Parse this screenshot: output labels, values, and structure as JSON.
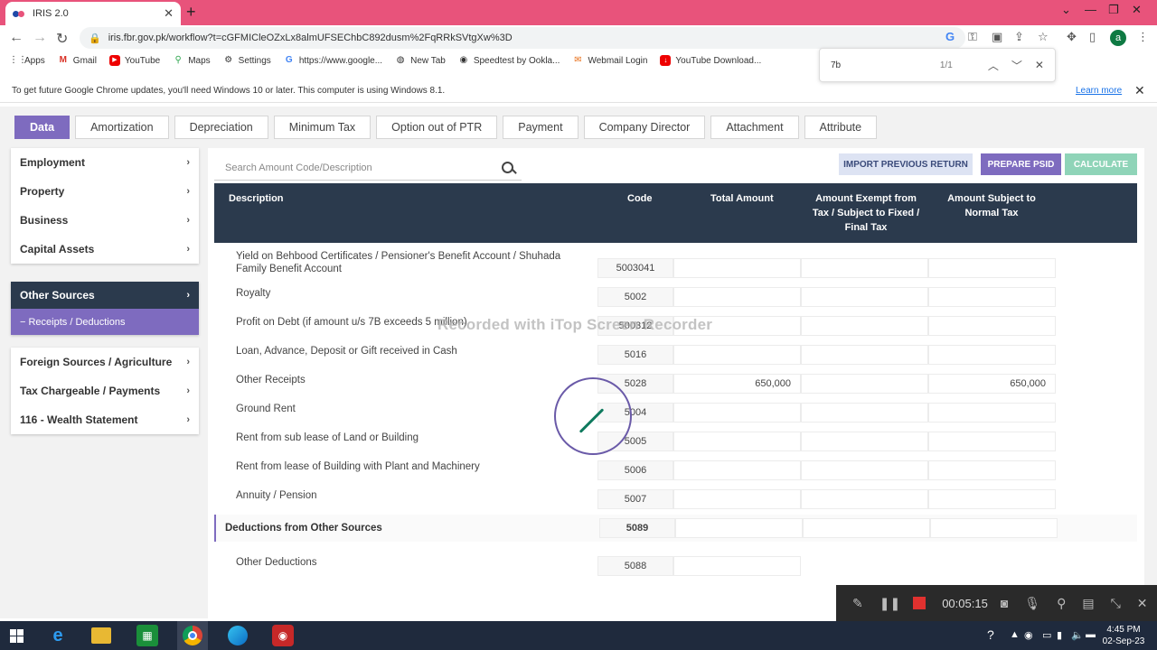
{
  "browser": {
    "tab_title": "IRIS 2.0",
    "url": "iris.fbr.gov.pk/workflow?t=cGFMICleOZxLx8almUFSEChbC892dusm%2FqRRkSVtgXw%3D",
    "profile_initial": "a",
    "bookmarks": [
      "Apps",
      "Gmail",
      "YouTube",
      "Maps",
      "Settings",
      "https://www.google...",
      "New Tab",
      "Speedtest by Ookla...",
      "Webmail Login",
      "YouTube Download..."
    ],
    "find": {
      "query": "7b",
      "count": "1/1"
    },
    "infobar": {
      "text": "To get future Google Chrome updates, you'll need Windows 10 or later. This computer is using Windows 8.1.",
      "learn_more": "Learn more"
    }
  },
  "tabs": [
    "Data",
    "Amortization",
    "Depreciation",
    "Minimum Tax",
    "Option out of PTR",
    "Payment",
    "Company Director",
    "Attachment",
    "Attribute"
  ],
  "sidebar": {
    "group1": [
      "Employment",
      "Property",
      "Business",
      "Capital Assets"
    ],
    "active": "Other Sources",
    "active_sub": "− Receipts / Deductions",
    "group3": [
      "Foreign Sources / Agriculture",
      "Tax Chargeable / Payments",
      "116 - Wealth Statement"
    ]
  },
  "search": {
    "placeholder": "Search Amount Code/Description"
  },
  "buttons": {
    "import": "IMPORT PREVIOUS RETURN",
    "psid": "PREPARE PSID",
    "calculate": "CALCULATE"
  },
  "table": {
    "headers": {
      "description": "Description",
      "code": "Code",
      "total": "Total Amount",
      "exempt": "Amount Exempt from Tax / Subject to Fixed / Final Tax",
      "normal": "Amount Subject to Normal Tax"
    },
    "rows": [
      {
        "desc": "Yield on Behbood Certificates / Pensioner's Benefit Account / Shuhada Family Benefit Account",
        "code": "5003041",
        "total": "",
        "normal": ""
      },
      {
        "desc": "Royalty",
        "code": "5002",
        "total": "",
        "normal": ""
      },
      {
        "desc": "Profit on Debt (if amount u/s 7B exceeds 5 million)",
        "code": "500312",
        "total": "",
        "normal": ""
      },
      {
        "desc": "Loan, Advance, Deposit or Gift received in Cash",
        "code": "5016",
        "total": "",
        "normal": ""
      },
      {
        "desc": "Other Receipts",
        "code": "5028",
        "total": "650,000",
        "normal": "650,000"
      },
      {
        "desc": "Ground Rent",
        "code": "5004",
        "total": "",
        "normal": ""
      },
      {
        "desc": "Rent from sub lease of Land or Building",
        "code": "5005",
        "total": "",
        "normal": ""
      },
      {
        "desc": "Rent from lease of Building with Plant and Machinery",
        "code": "5006",
        "total": "",
        "normal": ""
      },
      {
        "desc": "Annuity / Pension",
        "code": "5007",
        "total": "",
        "normal": ""
      }
    ],
    "deductions": {
      "desc": "Deductions from Other Sources",
      "code": "5089"
    },
    "other_deductions": {
      "desc": "Other Deductions",
      "code": "5088"
    }
  },
  "watermark": "Recorded with iTop Screen Recorder",
  "recorder": {
    "time": "00:05:15"
  },
  "clock": {
    "time": "4:45 PM",
    "date": "02-Sep-23"
  }
}
